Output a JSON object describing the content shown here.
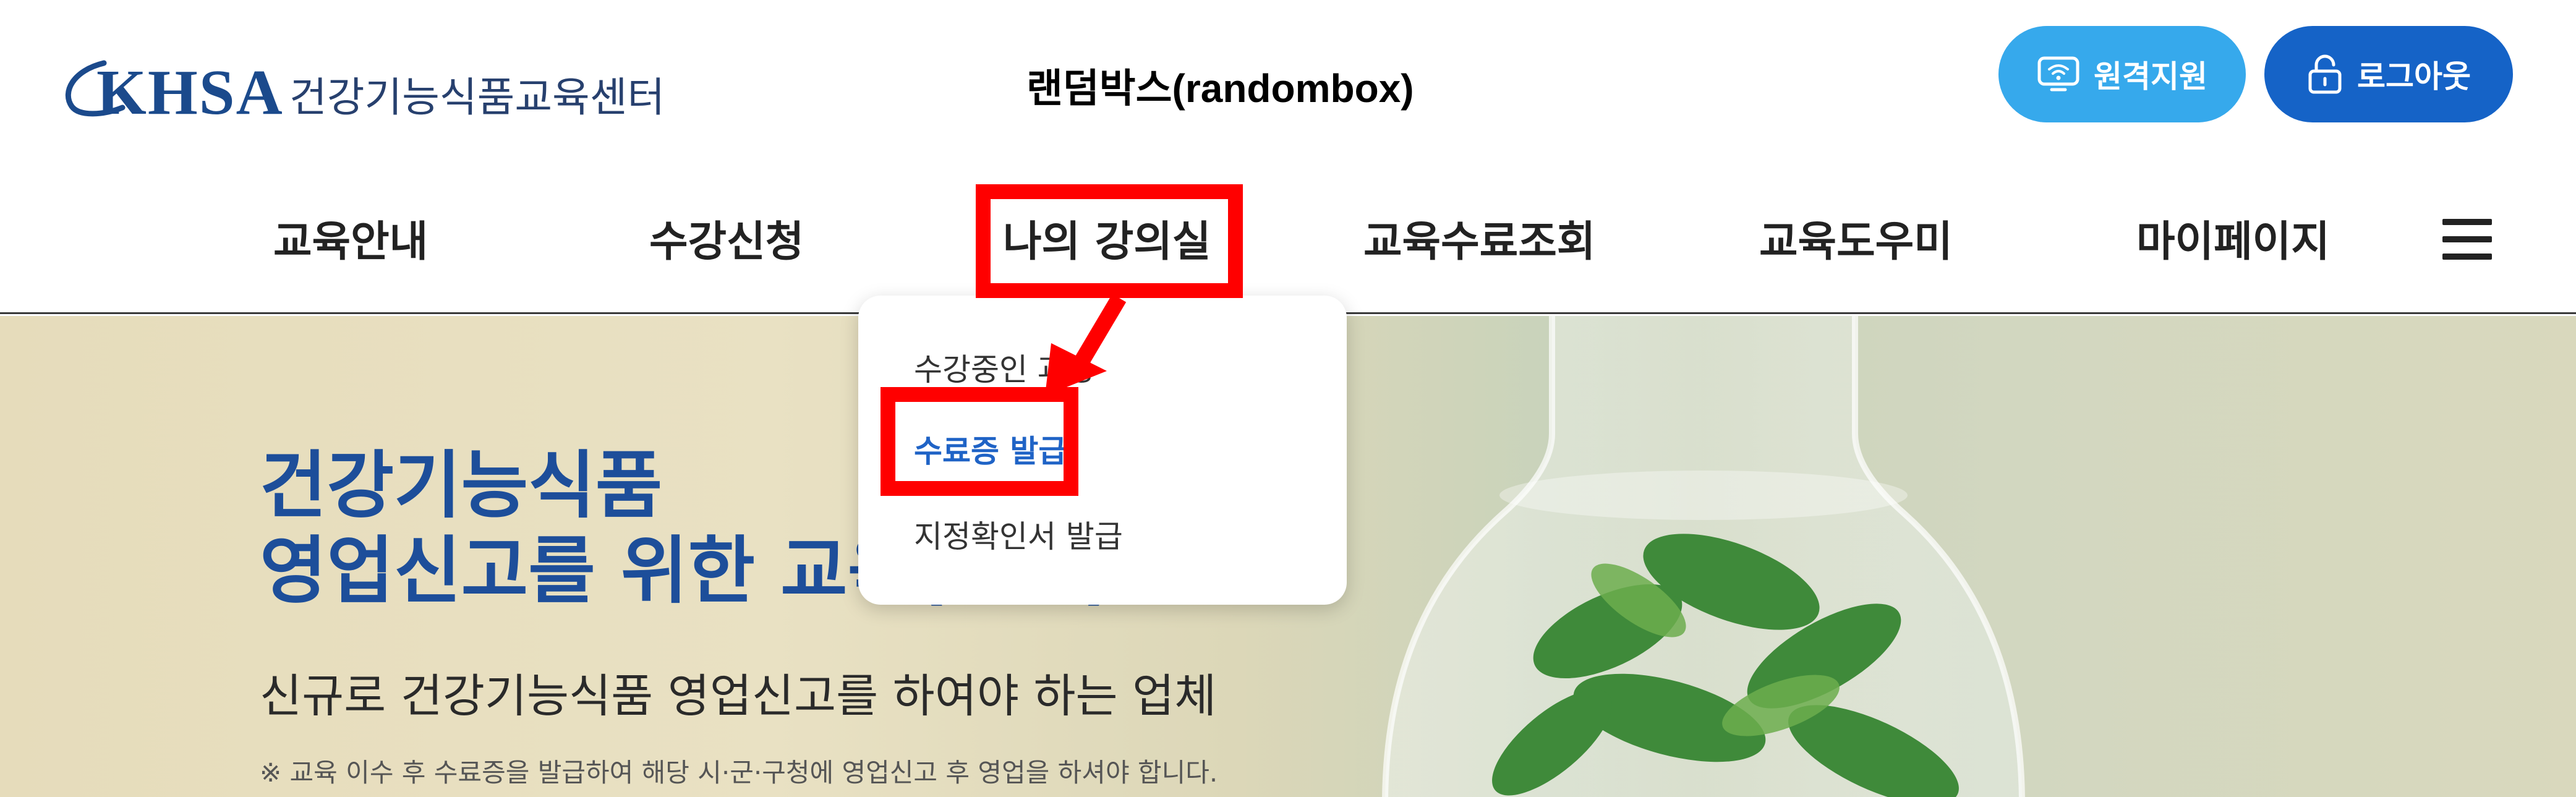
{
  "header": {
    "logo_text": "KHSA",
    "logo_subtitle": "건강기능식품교육센터",
    "center_title": "랜덤박스(randombox)",
    "remote_button": {
      "label": "원격지원",
      "icon": "monitor-wifi-icon",
      "color": "#36a9ec"
    },
    "logout_button": {
      "label": "로그아웃",
      "icon": "lock-icon",
      "color": "#1563c7"
    }
  },
  "nav": {
    "items": [
      {
        "label": "교육안내"
      },
      {
        "label": "수강신청"
      },
      {
        "label": "나의 강의실"
      },
      {
        "label": "교육수료조회"
      },
      {
        "label": "교육도우미"
      },
      {
        "label": "마이페이지"
      }
    ],
    "menu_icon": "hamburger-menu-icon"
  },
  "dropdown": {
    "items": [
      {
        "label": "수강중인 과정"
      },
      {
        "label": "수료증 발급",
        "active": true,
        "color": "#1f63c6"
      },
      {
        "label": "지정확인서 발급"
      }
    ]
  },
  "hero": {
    "title_line1": "건강기능식품",
    "title_line2": "영업신고를 위한 교육(필수)",
    "subtitle": "신규로 건강기능식품 영업신고를 하여야 하는 업체",
    "note": "※ 교육 이수 후 수료증을 발급하여 해당 시·군·구청에 영업신고 후 영업을 하셔야 합니다."
  },
  "annotations": {
    "highlight_color": "#ff0000"
  }
}
